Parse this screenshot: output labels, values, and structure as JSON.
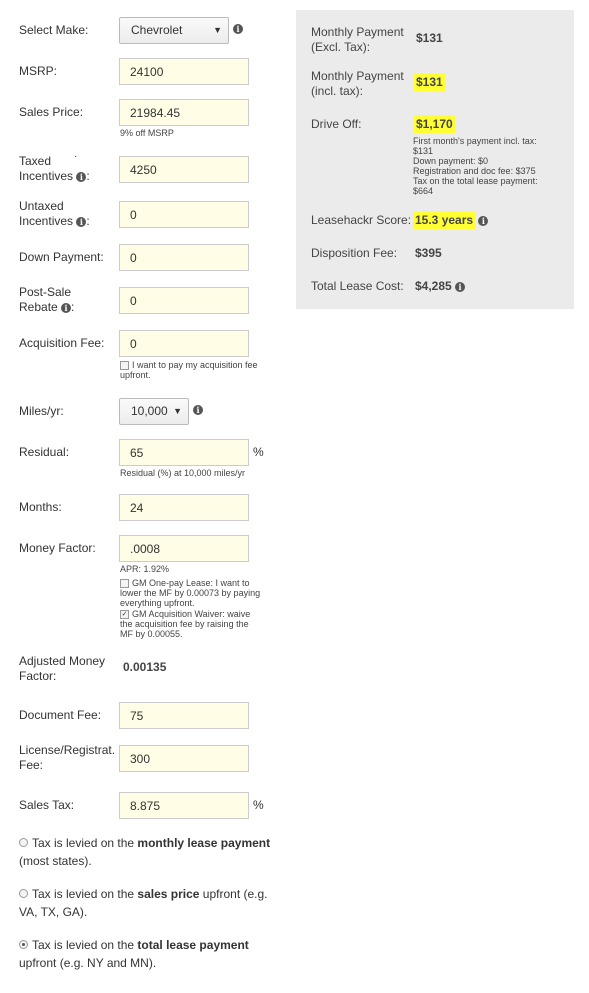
{
  "form": {
    "make": {
      "label": "Select Make:",
      "value": "Chevrolet",
      "caret": "▼",
      "info": "i"
    },
    "msrp": {
      "label": "MSRP:",
      "value": "24100"
    },
    "sales_price": {
      "label": "Sales Price:",
      "value": "21984.45",
      "hint": "9% off MSRP"
    },
    "taxed_incentives": {
      "label_line1": "Taxed",
      "label_line2": "Incentives",
      "info": "i",
      "colon": ":",
      "value": "4250",
      "dot": "·"
    },
    "untaxed_incentives": {
      "label_line1": "Untaxed",
      "label_line2": "Incentives",
      "info": "i",
      "colon": ":",
      "value": "0"
    },
    "down_payment": {
      "label": "Down Payment:",
      "value": "0"
    },
    "post_sale_rebate": {
      "label_line1": "Post-Sale",
      "label_line2": "Rebate",
      "info": "i",
      "colon": ":",
      "value": "0"
    },
    "acquisition_fee": {
      "label": "Acquisition Fee:",
      "value": "0",
      "checkbox_label": "I want to pay my acquisition fee upfront.",
      "checked": false
    },
    "miles": {
      "label": "Miles/yr:",
      "value": "10,000",
      "caret": "▼",
      "info": "i"
    },
    "residual": {
      "label": "Residual:",
      "value": "65",
      "unit": "%",
      "hint": "Residual (%) at 10,000 miles/yr"
    },
    "months": {
      "label": "Months:",
      "value": "24"
    },
    "money_factor": {
      "label": "Money Factor:",
      "value": ".0008",
      "apr": "APR: 1.92%",
      "option1": "GM One-pay Lease: I want to lower the MF by 0.00073 by paying everything upfront.",
      "option1_checked": false,
      "option2": "GM Acquisition Waiver: waive the acquisition fee by raising the MF by 0.00055.",
      "option2_checked": true,
      "check_mark": "✓"
    },
    "adjusted_mf": {
      "label_line1": "Adjusted Money",
      "label_line2": "Factor:",
      "value": "0.00135"
    },
    "document_fee": {
      "label": "Document Fee:",
      "value": "75"
    },
    "license_fee": {
      "label_line1": "License/Registrat.",
      "label_line2": "Fee:",
      "value": "300"
    },
    "sales_tax": {
      "label": "Sales Tax:",
      "value": "8.875",
      "unit": "%"
    },
    "tax_options": [
      {
        "pre": "Tax is levied on the ",
        "bold": "monthly lease payment",
        "post": "",
        "line2": "(most states).",
        "selected": false
      },
      {
        "pre": "Tax is levied on the ",
        "bold": "sales price",
        "post": " upfront (e.g.",
        "line2": "VA, TX, GA).",
        "selected": false
      },
      {
        "pre": "Tax is levied on the ",
        "bold": "total lease payment",
        "post": "",
        "line2": "upfront (e.g. NY and MN).",
        "selected": true
      }
    ]
  },
  "results": {
    "monthly_excl": {
      "label_line1": "Monthly Payment",
      "label_line2": "(Excl. Tax):",
      "value": "$131"
    },
    "monthly_incl": {
      "label_line1": "Monthly Payment",
      "label_line2": "(incl. tax):",
      "value": "$131"
    },
    "drive_off": {
      "label": "Drive Off:",
      "value": "$1,170",
      "breakdown": [
        "First month's payment incl. tax:",
        "$131",
        "Down payment: $0",
        "Registration and doc fee: $375",
        "Tax on the total lease payment:",
        "$664"
      ]
    },
    "leasehackr_score": {
      "label": "Leasehackr Score:",
      "value": "15.3 years",
      "info": "i"
    },
    "disposition_fee": {
      "label": "Disposition Fee:",
      "value": "$395"
    },
    "total_lease_cost": {
      "label": "Total Lease Cost:",
      "value": "$4,285",
      "info": "i"
    }
  },
  "colors": {
    "highlight": "#ffff33",
    "input_bg": "#fffde6",
    "panel_bg": "#ebebeb"
  }
}
